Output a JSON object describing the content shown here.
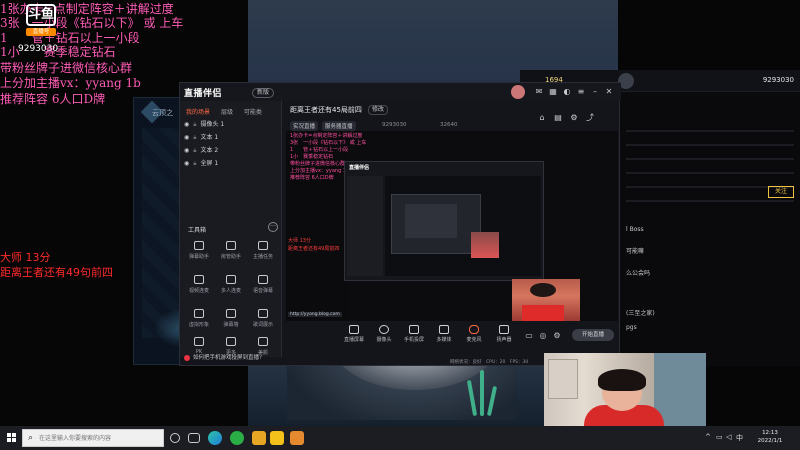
{
  "overlay": {
    "lines": [
      "1张办卡=点制定阵容＋讲解过度",
      "3张　一小段《钻石以下》 或 上车",
      "1　　管＋钻石以上一小段",
      "1小　　赛季稳定钻石",
      "带粉丝牌子进微信核心群",
      "上分加主播vx：yyang 1b",
      "推荐阵容 6人口D牌"
    ],
    "rank_line": "大师 13分",
    "goal_line": "距离王者还有49句前四",
    "logo_text": "斗鱼",
    "logo_sub": "直播号",
    "room_no": "9293030"
  },
  "game_window": {
    "title": "云顶之"
  },
  "topbar": {
    "stat": "1694",
    "number": "9293030"
  },
  "right_panel": {
    "number": "9293030",
    "lines": [
      "l Boss",
      "可能嘛",
      "么公会吗",
      "(三至之家)",
      "pgs"
    ],
    "button": "关注"
  },
  "app": {
    "logo": "直播伴侣",
    "version": "新版",
    "tabs": [
      {
        "label": "我的场景",
        "active": true
      },
      {
        "label": "层级",
        "active": false
      },
      {
        "label": "可能类",
        "active": false
      }
    ],
    "scenes": [
      "摄像头 1",
      "文本 1",
      "文本 2",
      "全屏 1"
    ],
    "tools_title": "工具箱",
    "tools_more": "···",
    "tools": [
      "弹幕助手",
      "房管助手",
      "主播任务",
      "视频连麦",
      "多人连麦",
      "语音弹幕",
      "虚拟形象",
      "弹幕墙",
      "歌词展示",
      "PK",
      "更多",
      "美颜"
    ],
    "hint": "如何把手机游戏投屏到直播？",
    "room_title": "距离王者还有45局前四",
    "edit_label": "修改",
    "tags": [
      "实况直播",
      "服务器直播"
    ],
    "room_id": "9293030",
    "fans": "32640",
    "preview": {
      "overlay_lines": [
        "1张办卡=点制定阵容＋讲解过度",
        "3张　一小段《钻石以下》 或 上车",
        "1　　管＋钻石以上一小段",
        "1小　赛季稳定钻石",
        "带粉丝牌子进微信核心群",
        "上分加主播vx：yyang 1b",
        "推荐阵容 6人口D牌"
      ],
      "rank_line": "大师 13分",
      "goal_line": "距离王者还有49局前四",
      "nested_logo": "直播伴侣",
      "url": "http://yyang.blog.com"
    },
    "bottom_buttons": [
      "直播屏幕",
      "摄像头",
      "手机投屏",
      "多媒体",
      "麦克风",
      "扬声器"
    ],
    "start_button": "开始直播",
    "status": "网络状况：良好　CPU：20　FPS：30"
  },
  "taskbar": {
    "search_placeholder": "在这里输入你要搜索的内容",
    "tray_lang": "中",
    "tray_lang2": "英",
    "time": "12:13",
    "date": "2022/1/1"
  }
}
